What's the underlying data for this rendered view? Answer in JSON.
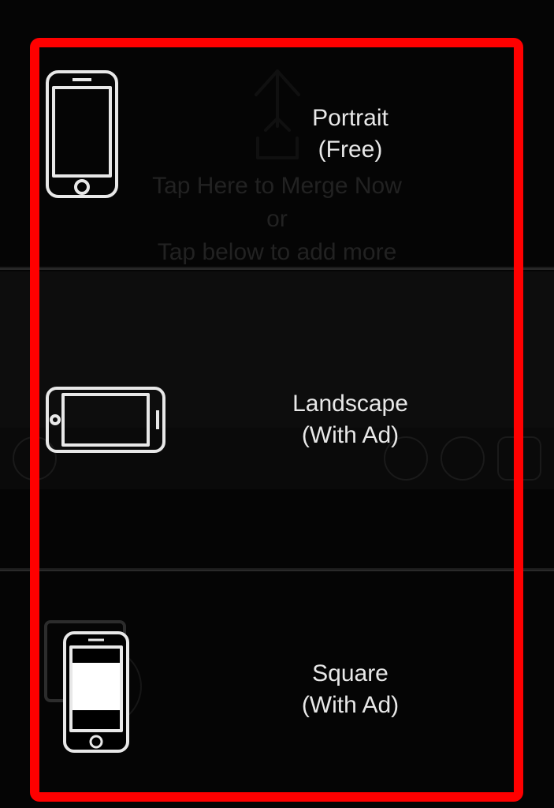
{
  "background": {
    "hint_line1": "Tap Here to Merge Now",
    "hint_line2": "or",
    "hint_line3": "Tap below to add more"
  },
  "menu": {
    "portrait": {
      "label": "Portrait\n(Free)"
    },
    "landscape": {
      "label": "Landscape\n(With Ad)"
    },
    "square": {
      "label": "Square\n(With Ad)"
    }
  }
}
